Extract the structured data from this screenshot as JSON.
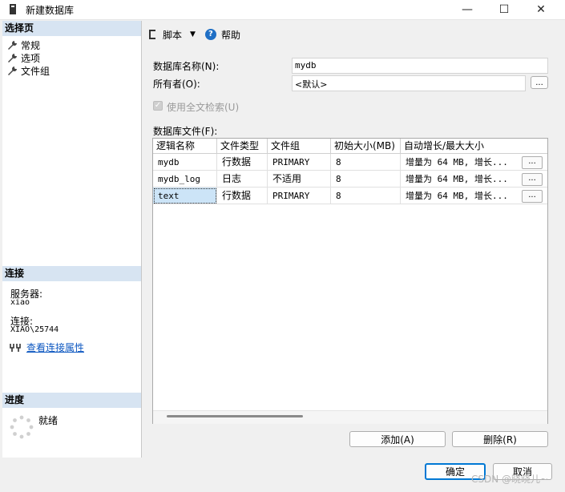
{
  "window": {
    "title": "新建数据库",
    "minimize": "—",
    "maximize": "☐",
    "close": "✕"
  },
  "left": {
    "select_page_header": "选择页",
    "pages": [
      {
        "label": "常规"
      },
      {
        "label": "选项"
      },
      {
        "label": "文件组"
      }
    ],
    "connection_header": "连接",
    "server_label": "服务器:",
    "server_value": "xiao",
    "connection_label": "连接:",
    "connection_value": "XIAO\\25744",
    "view_props_link": "查看连接属性",
    "progress_header": "进度",
    "progress_status": "就绪"
  },
  "toolbar": {
    "script_label": "脚本",
    "script_arrow": "▼",
    "help_label": "帮助",
    "help_icon": "?"
  },
  "form": {
    "db_name_label": "数据库名称(N):",
    "db_name_value": "mydb",
    "owner_label": "所有者(O):",
    "owner_value": "<默认>",
    "owner_browse": "...",
    "fulltext_label": "使用全文检索(U)",
    "fulltext_checked": true,
    "db_files_label": "数据库文件(F):"
  },
  "grid": {
    "columns": [
      "逻辑名称",
      "文件类型",
      "文件组",
      "初始大小(MB)",
      "自动增长/最大大小"
    ],
    "rows": [
      {
        "name": "mydb",
        "type": "行数据",
        "group": "PRIMARY",
        "size": "8",
        "growth": "增量为 64 MB, 增长...",
        "btn": "..."
      },
      {
        "name": "mydb_log",
        "type": "日志",
        "group": "不适用",
        "size": "8",
        "growth": "增量为 64 MB, 增长...",
        "btn": "..."
      },
      {
        "name": "text",
        "type": "行数据",
        "group": "PRIMARY",
        "size": "8",
        "growth": "增量为 64 MB, 增长...",
        "btn": "..."
      }
    ]
  },
  "actions": {
    "add_label": "添加(A)",
    "remove_label": "删除(R)",
    "ok_label": "确定",
    "cancel_label": "取消"
  },
  "watermark": "CSDN @晓晓儿~",
  "colors": {
    "section_header": "#d7e4f2",
    "link": "#0b56c0",
    "selected_cell": "#cce4f7",
    "help_icon": "#1f6fc5"
  }
}
